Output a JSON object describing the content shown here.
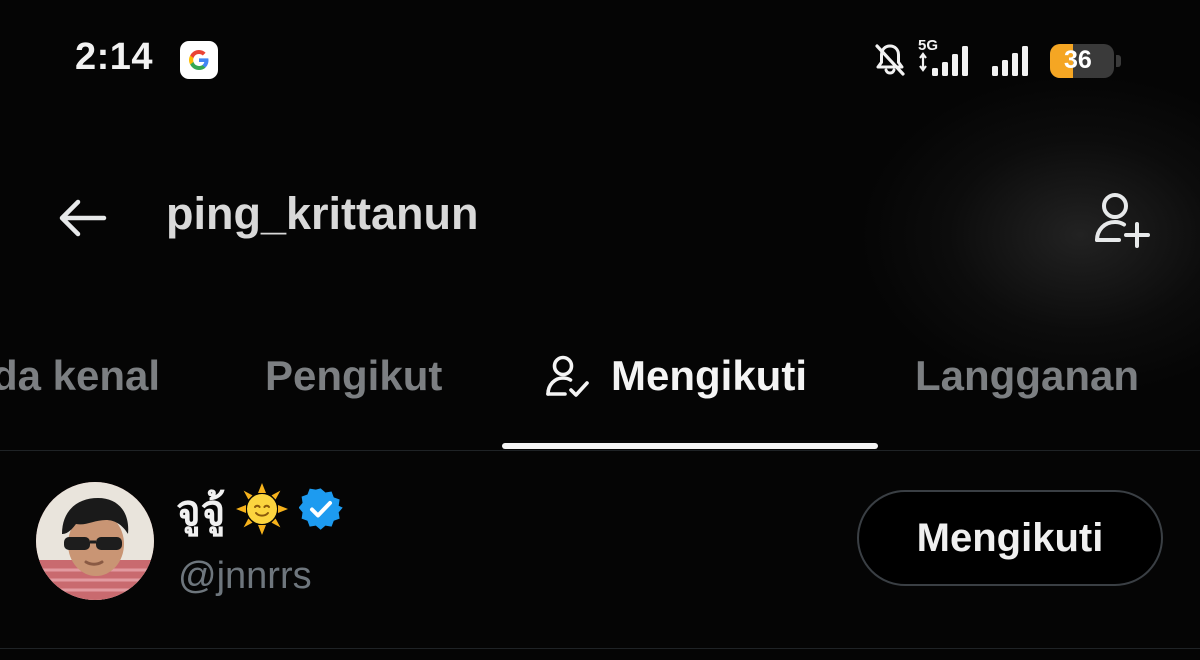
{
  "status_bar": {
    "time": "2:14",
    "network": "5G",
    "battery": "36",
    "battery_level": 0.36,
    "battery_color": "#f5a623",
    "icons": [
      "google-icon",
      "bell-off-icon",
      "signal-icon",
      "signal-icon",
      "battery-icon"
    ]
  },
  "header": {
    "title": "ping_krittanun",
    "back_icon": "arrow-left-icon",
    "add_user_icon": "person-plus-icon"
  },
  "tabs": [
    {
      "label": "da kenal",
      "active": false
    },
    {
      "label": "Pengikut",
      "active": false
    },
    {
      "label": "Mengikuti",
      "active": true,
      "icon": "person-check-icon"
    },
    {
      "label": "Langganan",
      "active": false
    }
  ],
  "list": {
    "items": [
      {
        "name": "จูจู้",
        "emoji": "🌞",
        "verified": true,
        "verified_color": "#1d9bf0",
        "handle": "@jnnrrs",
        "button_label": "Mengikuti"
      }
    ]
  }
}
